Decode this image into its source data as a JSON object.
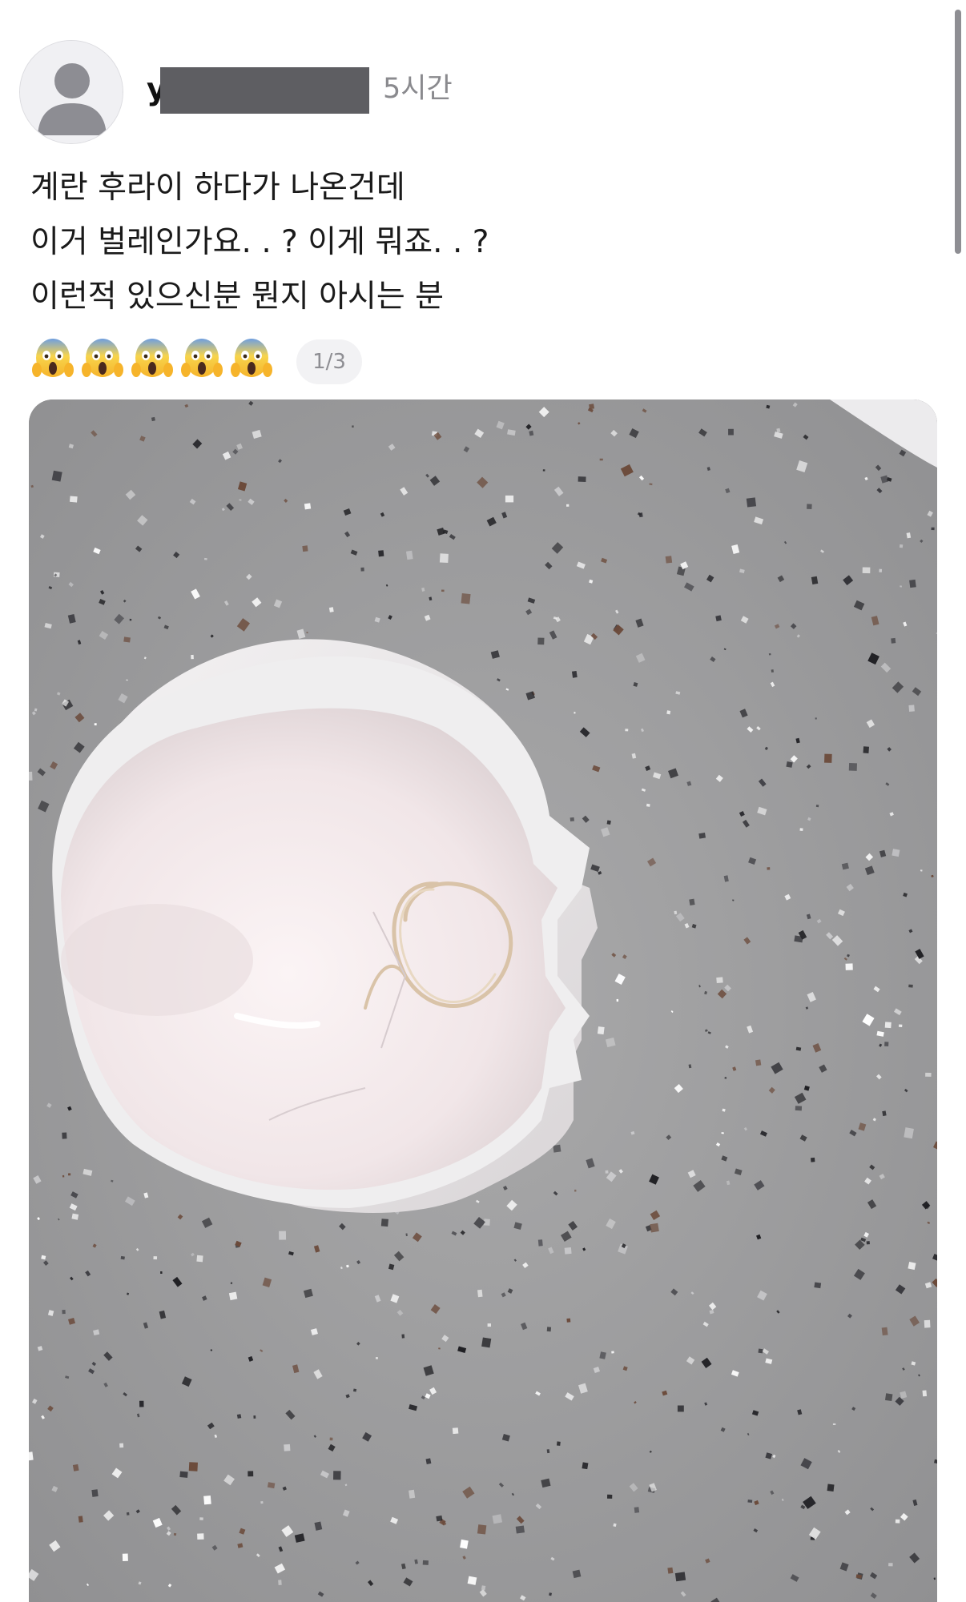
{
  "post": {
    "author_visible": "y",
    "time_ago": "5시간",
    "body_lines": [
      "계란 후라이 하다가 나온건데",
      "이거 벌레인가요. . ? 이게 뭐죠. . ?",
      "이런적 있으신분 뭔지 아시는 분"
    ],
    "emoji_icons": [
      "face-screaming-in-fear-icon",
      "face-screaming-in-fear-icon",
      "face-screaming-in-fear-icon",
      "face-screaming-in-fear-icon",
      "face-screaming-in-fear-icon"
    ],
    "image_counter": "1/3"
  },
  "colors": {
    "timestamp": "#8a8a8e",
    "redaction": "#5e5e62",
    "counter_bg": "#f2f2f4"
  }
}
